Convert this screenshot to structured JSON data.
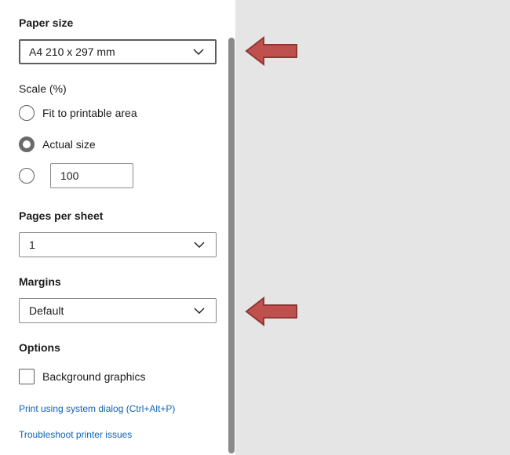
{
  "paper_size": {
    "title": "Paper size",
    "value": "A4 210 x 297 mm"
  },
  "scale": {
    "title": "Scale (%)",
    "options": [
      {
        "label": "Fit to printable area",
        "checked": false
      },
      {
        "label": "Actual size",
        "checked": true
      },
      {
        "label": "",
        "checked": false
      }
    ],
    "custom_value": "100"
  },
  "pages_per_sheet": {
    "title": "Pages per sheet",
    "value": "1"
  },
  "margins": {
    "title": "Margins",
    "value": "Default"
  },
  "options": {
    "title": "Options",
    "background_graphics_label": "Background graphics",
    "background_graphics_checked": false
  },
  "links": {
    "system_dialog": "Print using system dialog (Ctrl+Alt+P)",
    "troubleshoot": "Troubleshoot printer issues"
  },
  "colors": {
    "arrow_fill": "#c0504d",
    "arrow_stroke": "#8c3836",
    "preview_bg": "#e5e5e5",
    "link": "#0f63b6"
  },
  "icons": {
    "dropdown": "chevron-down-icon",
    "annotation": "left-arrow-annotation"
  }
}
